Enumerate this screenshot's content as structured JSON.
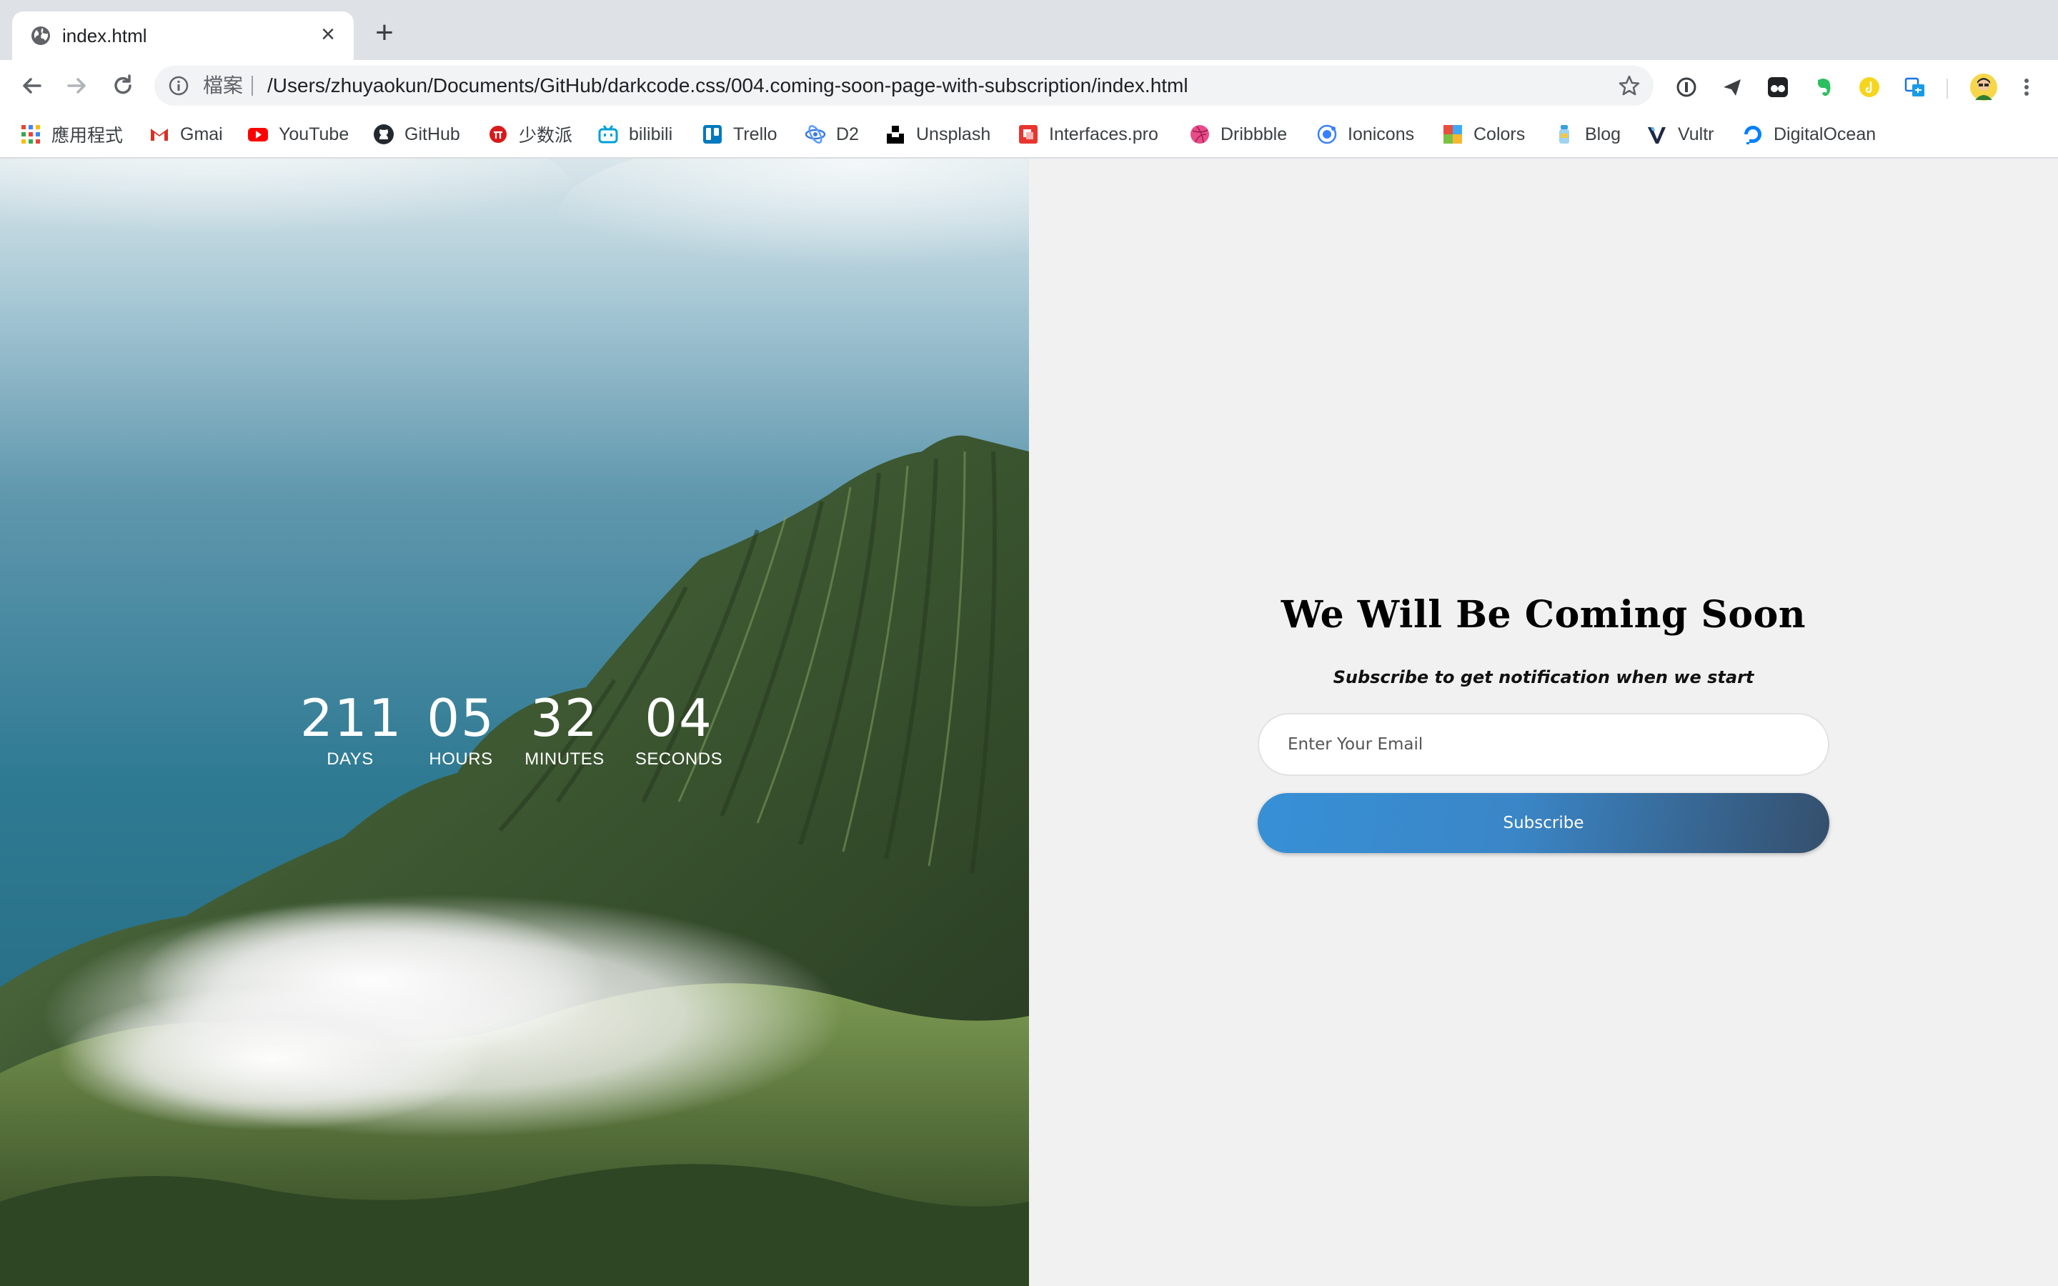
{
  "browser": {
    "tab": {
      "title": "index.html",
      "close_icon": "close-icon",
      "favicon": "globe-icon"
    },
    "new_tab_icon": "plus-icon",
    "address_bar": {
      "scheme_label": "檔案",
      "url": "/Users/zhuyaokun/Documents/GitHub/darkcode.css/004.coming-soon-page-with-subscription/index.html"
    },
    "bookmarks": [
      {
        "label": "應用程式",
        "icon": "apps-grid-icon"
      },
      {
        "label": "Gmai",
        "icon": "gmail-icon"
      },
      {
        "label": "YouTube",
        "icon": "youtube-icon"
      },
      {
        "label": "GitHub",
        "icon": "github-icon"
      },
      {
        "label": "少数派",
        "icon": "sspai-icon"
      },
      {
        "label": "bilibili",
        "icon": "bilibili-icon"
      },
      {
        "label": "Trello",
        "icon": "trello-icon"
      },
      {
        "label": "D2",
        "icon": "d2-icon"
      },
      {
        "label": "Unsplash",
        "icon": "unsplash-icon"
      },
      {
        "label": "Interfaces.pro",
        "icon": "interfaces-icon"
      },
      {
        "label": "Dribbble",
        "icon": "dribbble-icon"
      },
      {
        "label": "Ionicons",
        "icon": "ionicons-icon"
      },
      {
        "label": "Colors",
        "icon": "colors-icon"
      },
      {
        "label": "Blog",
        "icon": "blog-icon"
      },
      {
        "label": "Vultr",
        "icon": "vultr-icon"
      },
      {
        "label": "DigitalOcean",
        "icon": "digitalocean-icon"
      }
    ]
  },
  "countdown": [
    {
      "value": "211",
      "label": "DAYS"
    },
    {
      "value": "05",
      "label": "HOURS"
    },
    {
      "value": "32",
      "label": "MINUTES"
    },
    {
      "value": "04",
      "label": "SECONDS"
    }
  ],
  "signup": {
    "headline": "We Will Be Coming Soon",
    "subheadline": "Subscribe to get notification when we start",
    "email_placeholder": "Enter Your Email",
    "email_value": "",
    "button_label": "Subscribe"
  },
  "colors": {
    "button_start": "#3790d6",
    "button_end": "#354f6c",
    "panel_background": "#f1f1f1"
  }
}
